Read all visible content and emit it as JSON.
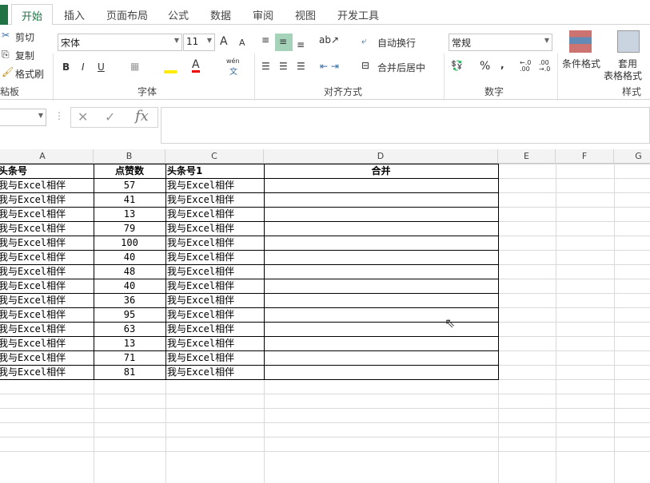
{
  "tabs": [
    "开始",
    "插入",
    "页面布局",
    "公式",
    "数据",
    "审阅",
    "视图",
    "开发工具"
  ],
  "clipboard": {
    "cut": "剪切",
    "copy": "复制",
    "painter": "格式刷",
    "group": "粘板"
  },
  "font": {
    "name": "宋体",
    "size": "11",
    "bold": "B",
    "italic": "I",
    "underline": "U",
    "phonetic": "wén",
    "phonetic2": "文",
    "group": "字体",
    "font_color_letter": "A",
    "grow": "A",
    "shrink": "A"
  },
  "alignment": {
    "wrap": "自动换行",
    "merge": "合并后居中",
    "group": "对齐方式"
  },
  "number": {
    "format": "常规",
    "percent": "%",
    "comma": ",",
    "inc": "←.0 .00",
    "dec": ".00 →.0",
    "group": "数字"
  },
  "styles": {
    "conditional": "条件格式",
    "table1": "套用",
    "table2": "表格格式",
    "group": "样式"
  },
  "formula_bar": {
    "fx": "fx",
    "cancel": "✕",
    "enter": "✓"
  },
  "columns": [
    "A",
    "B",
    "C",
    "D",
    "E",
    "F",
    "G"
  ],
  "header_row": {
    "a": "头条号",
    "b": "点赞数",
    "c": "头条号1",
    "d": "合并"
  },
  "rows": [
    {
      "a": "我与Excel相伴",
      "b": "57",
      "c": "我与Excel相伴"
    },
    {
      "a": "我与Excel相伴",
      "b": "41",
      "c": "我与Excel相伴"
    },
    {
      "a": "我与Excel相伴",
      "b": "13",
      "c": "我与Excel相伴"
    },
    {
      "a": "我与Excel相伴",
      "b": "79",
      "c": "我与Excel相伴"
    },
    {
      "a": "我与Excel相伴",
      "b": "100",
      "c": "我与Excel相伴"
    },
    {
      "a": "我与Excel相伴",
      "b": "40",
      "c": "我与Excel相伴"
    },
    {
      "a": "我与Excel相伴",
      "b": "48",
      "c": "我与Excel相伴"
    },
    {
      "a": "我与Excel相伴",
      "b": "40",
      "c": "我与Excel相伴"
    },
    {
      "a": "我与Excel相伴",
      "b": "36",
      "c": "我与Excel相伴"
    },
    {
      "a": "我与Excel相伴",
      "b": "95",
      "c": "我与Excel相伴"
    },
    {
      "a": "我与Excel相伴",
      "b": "63",
      "c": "我与Excel相伴"
    },
    {
      "a": "我与Excel相伴",
      "b": "13",
      "c": "我与Excel相伴"
    },
    {
      "a": "我与Excel相伴",
      "b": "71",
      "c": "我与Excel相伴"
    },
    {
      "a": "我与Excel相伴",
      "b": "81",
      "c": "我与Excel相伴"
    }
  ]
}
